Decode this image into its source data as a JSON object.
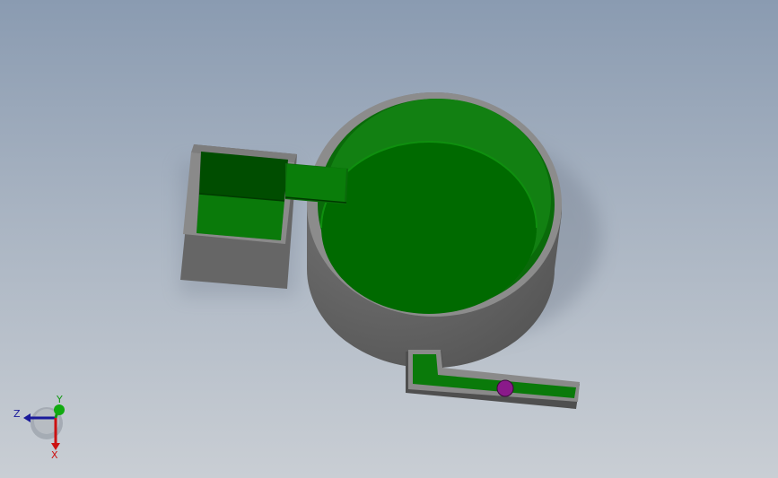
{
  "triad": {
    "axes": [
      {
        "key": "z",
        "label": "Z"
      },
      {
        "key": "y",
        "label": "Y"
      },
      {
        "key": "x",
        "label": "X"
      }
    ]
  },
  "colors": {
    "background_top": "#8a9bb1",
    "background_bottom": "#c9ced4",
    "body_gray": "#6c6c6c",
    "rim_gray": "#8f8f8f",
    "fluid_green": "#0a8c0a",
    "dark_green": "#004c00",
    "ball_purple": "#8a1a8a",
    "axis_x": "#cc1111",
    "axis_y": "#119911",
    "axis_z": "#1a1a9a"
  }
}
